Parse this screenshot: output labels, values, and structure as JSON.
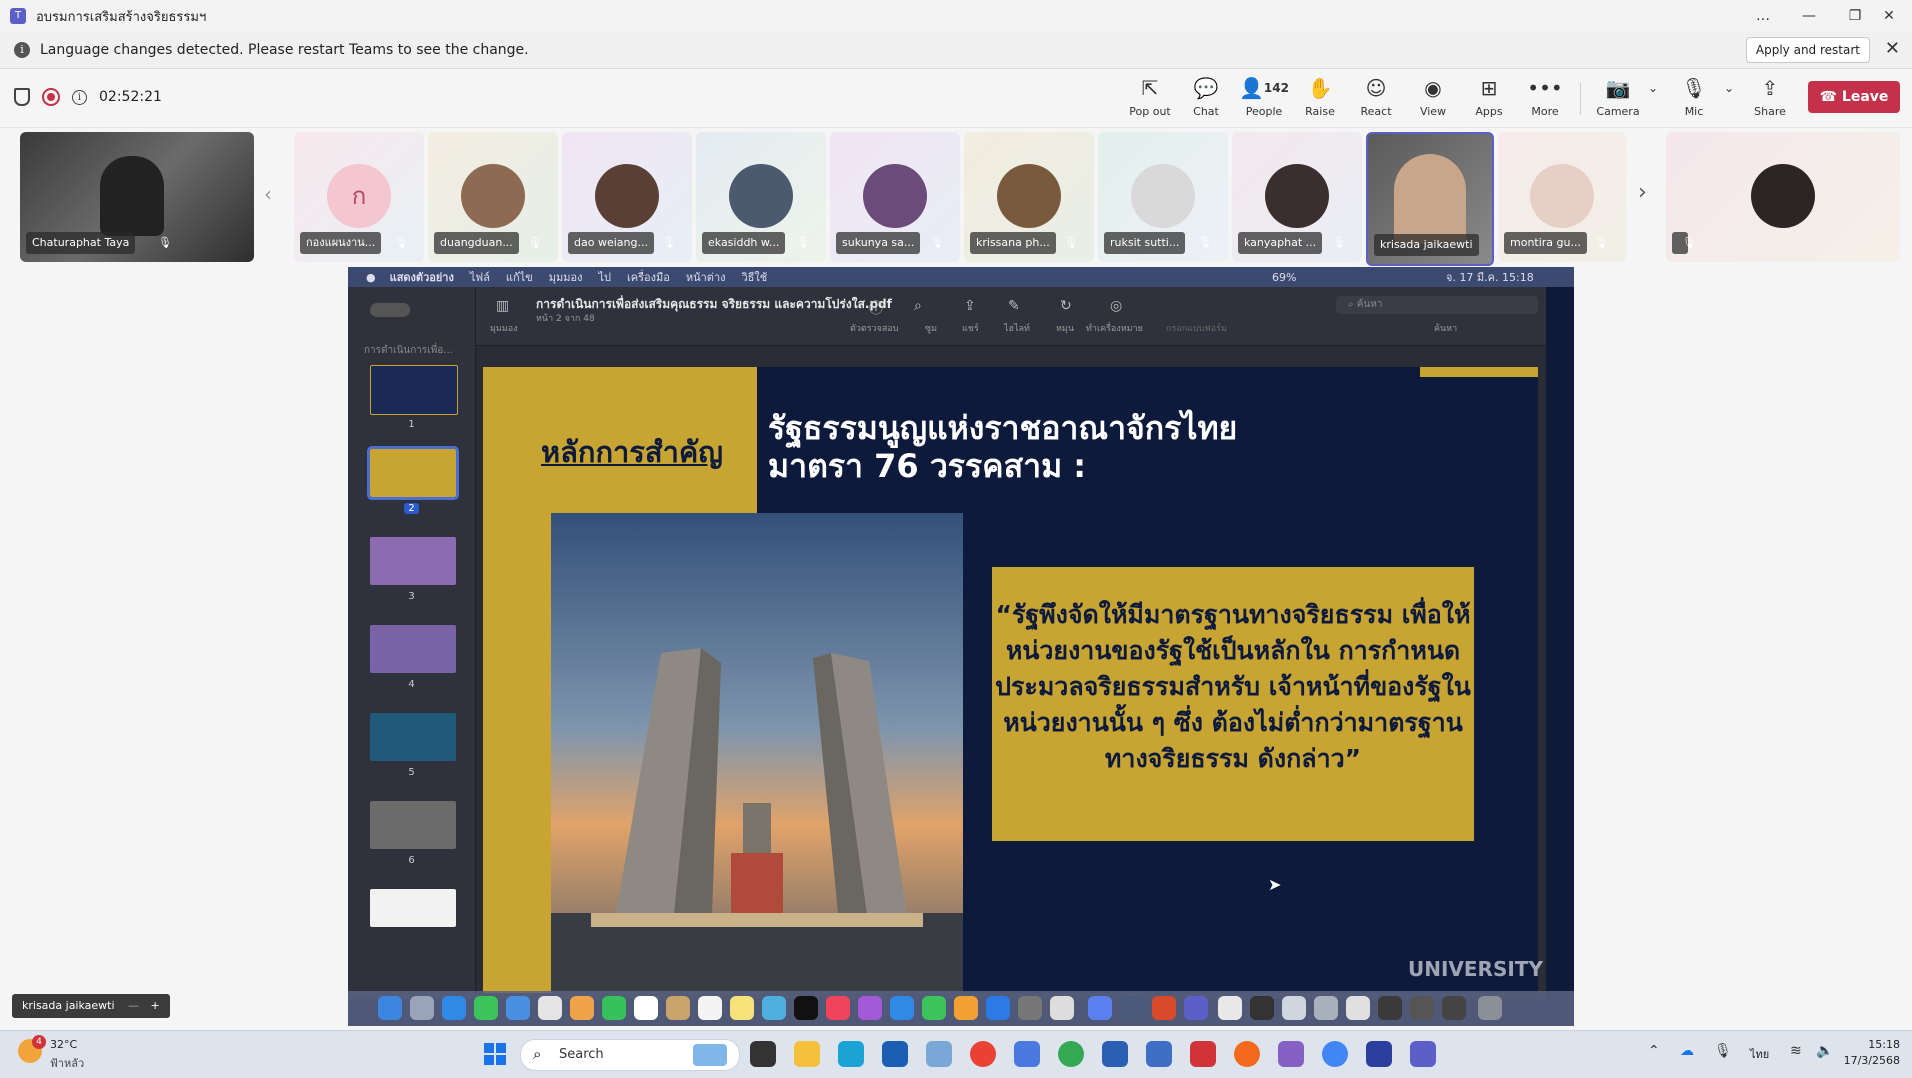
{
  "window": {
    "title": "อบรมการเสริมสร้างจริยธรรมฯ",
    "controls": [
      "…",
      "—",
      "❐",
      "✕"
    ]
  },
  "banner": {
    "message": "Language changes detected. Please restart Teams to see the change.",
    "apply_label": "Apply and restart"
  },
  "meeting": {
    "timer": "02:52:21",
    "toolbar": {
      "popout": "Pop out",
      "chat": "Chat",
      "people": "People",
      "people_count": "142",
      "raise": "Raise",
      "react": "React",
      "view": "View",
      "apps": "Apps",
      "more": "More",
      "camera": "Camera",
      "mic": "Mic",
      "share": "Share",
      "leave": "Leave"
    }
  },
  "participants": [
    {
      "name": "Chaturaphat Taya"
    },
    {
      "name": "กองแผนงาน...",
      "initial": "ก"
    },
    {
      "name": "duangduan..."
    },
    {
      "name": "dao weiang..."
    },
    {
      "name": "ekasiddh w..."
    },
    {
      "name": "sukunya sa..."
    },
    {
      "name": "krissana ph..."
    },
    {
      "name": "ruksit sutti..."
    },
    {
      "name": "kanyaphat ..."
    },
    {
      "name": "krisada jaikaewti"
    },
    {
      "name": "montira gu..."
    },
    {
      "name": ""
    }
  ],
  "shared_screen": {
    "mac_menu": [
      "แสดงตัวอย่าง",
      "ไฟล์",
      "แก้ไข",
      "มุมมอง",
      "ไป",
      "เครื่องมือ",
      "หน้าต่าง",
      "วิธีใช้"
    ],
    "mac_status": {
      "battery": "69%",
      "datetime": "จ. 17 มี.ค. 15:18"
    },
    "pdf": {
      "filename": "การดำเนินการเพื่อส่งเสริมคุณธรรม จริยธรรม และความโปร่งใส.pdf",
      "page_info": "หน้า 2 จาก 48",
      "sidebar_header": "การดำเนินการเพื่อ...",
      "view_label": "มุมมอง",
      "toolbar_labels": [
        "ตัวตรวจสอบ",
        "ซูม",
        "แชร์",
        "ไฮไลท์",
        "หมุน",
        "ทำเครื่องหมาย",
        "กรอกแบบฟอร์ม",
        "ค้นหา"
      ],
      "search_placeholder": "ค้นหา",
      "thumbnails": [
        "1",
        "2",
        "3",
        "4",
        "5",
        "6"
      ],
      "selected_page": "2"
    },
    "slide": {
      "label": "หลักการสำคัญ",
      "title_line1": "รัฐธรรมนูญแห่งราชอาณาจักรไทย",
      "title_line2": "มาตรา 76 วรรคสาม :",
      "quote": "“รัฐพึงจัดให้มีมาตรฐานทางจริยธรรม เพื่อให้หน่วยงานของรัฐใช้เป็นหลักใน การกำหนดประมวลจริยธรรมสำหรับ เจ้าหน้าที่ของรัฐในหน่วยงานนั้น ๆ ซึ่ง ต้องไม่ต่ำกว่ามาตรฐานทางจริยธรรม ดังกล่าว”"
    },
    "background_text": "UNIVERSITY"
  },
  "pip": {
    "name": "krisada jaikaewti"
  },
  "taskbar": {
    "weather_temp": "32°C",
    "weather_desc": "ฟ้าหลัว",
    "weather_badge": "4",
    "search": "Search",
    "lang": "ไทย",
    "time": "15:18",
    "date": "17/3/2568"
  }
}
